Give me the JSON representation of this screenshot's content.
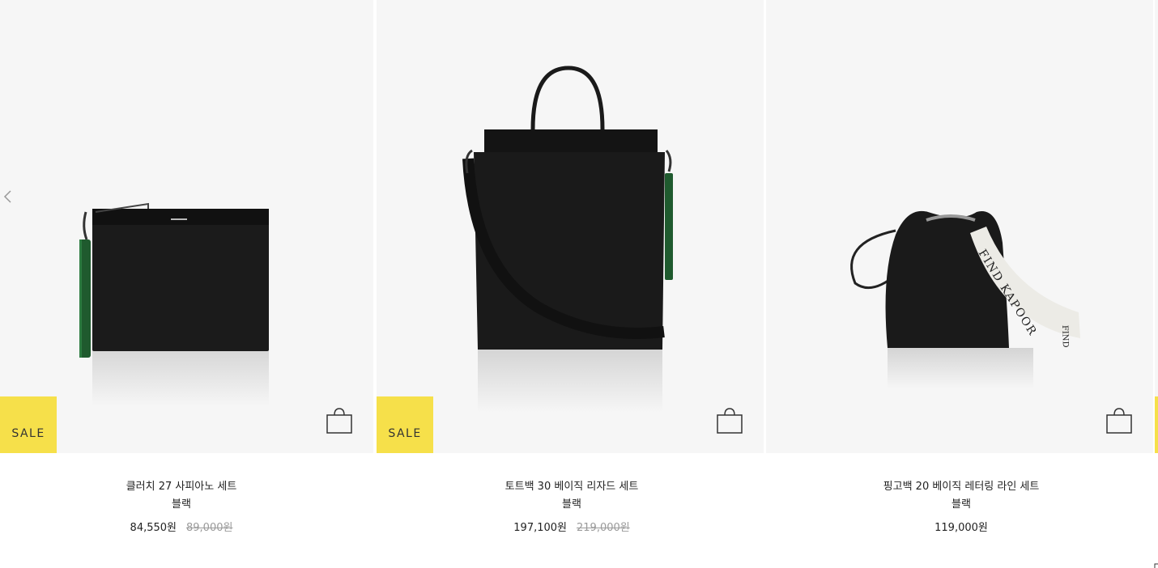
{
  "carousel": {
    "prev_icon": "chevron-left-icon",
    "cart_icon": "shopping-bag-icon",
    "items": [
      {
        "name": "클러치 27 사피아노 세트",
        "color": "블랙",
        "price": "84,550원",
        "original_price": "89,000원",
        "badge": "SALE"
      },
      {
        "name": "토트백 30 베이직 리자드 세트",
        "color": "블랙",
        "price": "197,100원",
        "original_price": "219,000원",
        "badge": "SALE"
      },
      {
        "name": "핑고백 20 베이직 레터링 라인 세트",
        "color": "블랙",
        "price": "119,000원"
      }
    ],
    "strap_text": "FIND KAPOOR",
    "strap_text_short": "FIND",
    "colors": {
      "sale_badge": "#f6e04a",
      "image_bg": "#f6f6f6",
      "strikethrough_price": "#9a9a9a"
    }
  }
}
